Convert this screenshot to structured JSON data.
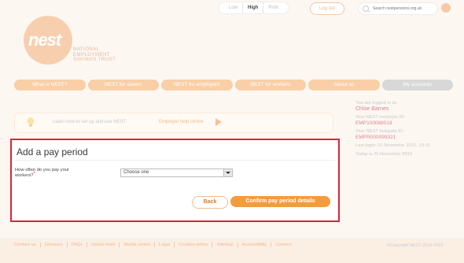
{
  "utility": {
    "contrast_options": [
      "Low",
      "High",
      "Print"
    ],
    "logout_label": "Log out",
    "search_placeholder": "Search nestpensions.org.uk"
  },
  "logo": {
    "name": "nest",
    "sub_line1": "NATIONAL",
    "sub_line2": "EMPLOYMENT",
    "sub_line3": "SAVINGS TRUST"
  },
  "nav": {
    "items": [
      "What is NEST?",
      "NEST for savers",
      "NEST for employers",
      "NEST for workers",
      "About us",
      "My accounts"
    ]
  },
  "sidebar": {
    "logged_in_label": "You are logged in as",
    "user_name": "Chloe Barnes",
    "employer_id_label": "Your NEST employer ID:",
    "employer_id": "EMP100088019",
    "delegate_id_label": "Your NEST delegate ID:",
    "delegate_id": "EMPR000099321",
    "last_login": "Last login: 21 November 2015, 13:11",
    "today": "Today is 25 November 2015"
  },
  "banner": {
    "text": "Learn how to set up and use NEST.",
    "link": "Employer help centre"
  },
  "form": {
    "title": "Add a pay period",
    "question_line1": "How often do you pay your",
    "question_line2": "workers?",
    "required_mark": "*",
    "select_value": "Choose one",
    "back_label": "Back",
    "confirm_label": "Confirm pay period details"
  },
  "footer": {
    "links": [
      "Contact us",
      "Glossary",
      "FAQs",
      "Useful tools",
      "Media centre",
      "Legal",
      "Cookies policy",
      "Sitemap",
      "Accessibility",
      "Careers"
    ],
    "copyright": "©Copyright NEST 2014-2015"
  }
}
